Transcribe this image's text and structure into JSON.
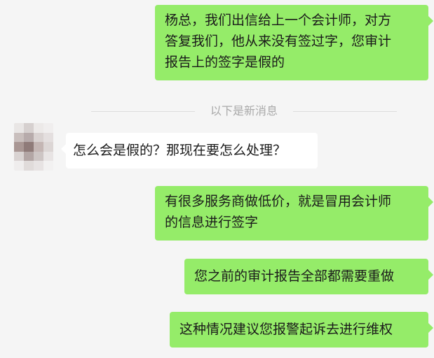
{
  "chat": {
    "messages": [
      {
        "from": "me",
        "lines": [
          "杨总，我们出信给上一个会计师，对方",
          "答复我们，他从来没有签过字，您审计",
          "报告上的签字是假的"
        ]
      },
      {
        "from": "them",
        "lines": [
          "怎么会是假的？那现在要怎么处理？"
        ]
      },
      {
        "from": "me",
        "lines": [
          "有很多服务商做低价，就是冒用会计师",
          "的信息进行签字"
        ]
      },
      {
        "from": "me",
        "lines": [
          "您之前的审计报告全部都需要重做"
        ]
      },
      {
        "from": "me",
        "lines": [
          "这种情况建议您报警起诉去进行维权"
        ]
      }
    ],
    "new_messages_divider": "以下是新消息"
  },
  "avatar": {
    "name": "contact-avatar",
    "pixel_colors": [
      "#e9e6e5",
      "#d6d0cf",
      "#ece9e8",
      "#f0eeee",
      "#c9bfbd",
      "#b7abab",
      "#d9d2d1",
      "#e4dfdf",
      "#a99794",
      "#8f7b79",
      "#c4b6b4",
      "#dcd6d5",
      "#d9d3d2",
      "#b3a6a5",
      "#cdc5c4",
      "#e8e4e4",
      "#efeded",
      "#e0dbda",
      "#e7e3e3",
      "#f2f1f1"
    ]
  },
  "colors": {
    "outgoing_bubble": "#95ec69",
    "incoming_bubble": "#ffffff",
    "background": "#f5f5f5",
    "divider_text": "#a9a9a9"
  }
}
